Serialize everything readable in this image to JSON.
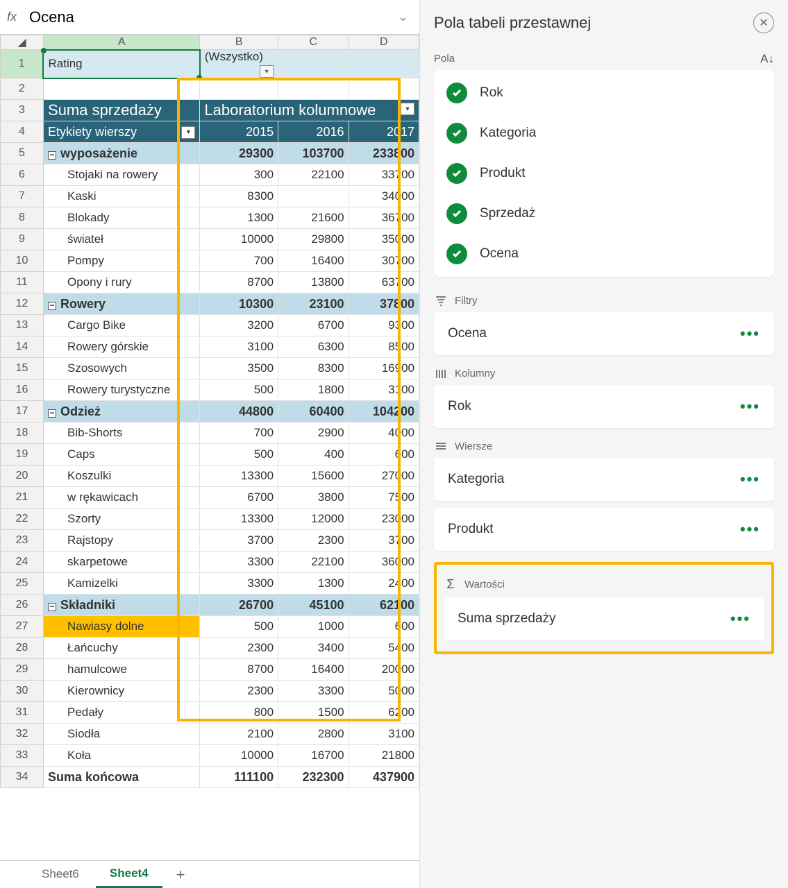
{
  "formula_bar": {
    "fx": "fx",
    "value": "Ocena"
  },
  "columns": [
    "A",
    "B",
    "C",
    "D"
  ],
  "active_cell": "Rating",
  "filter_all": "(Wszystko)",
  "pivot_header": {
    "measure": "Suma sprzedaży",
    "col_label": "Laboratorium kolumnowe"
  },
  "row_labels_header": "Etykiety wierszy",
  "years": [
    "2015",
    "2016",
    "2017"
  ],
  "groups": [
    {
      "name": "wyposażenie",
      "totals": [
        "29300",
        "103700",
        "233800"
      ],
      "rows": [
        {
          "p": "Stojaki na rowery",
          "v": [
            "300",
            "22100",
            "33700"
          ]
        },
        {
          "p": "Kaski",
          "v": [
            "8300",
            "",
            "34000"
          ]
        },
        {
          "p": "Blokady",
          "v": [
            "1300",
            "21600",
            "36700"
          ]
        },
        {
          "p": "świateł",
          "v": [
            "10000",
            "29800",
            "35000"
          ]
        },
        {
          "p": "Pompy",
          "v": [
            "700",
            "16400",
            "30700"
          ]
        },
        {
          "p": "Opony i rury",
          "v": [
            "8700",
            "13800",
            "63700"
          ]
        }
      ]
    },
    {
      "name": "Rowery",
      "totals": [
        "10300",
        "23100",
        "37800"
      ],
      "rows": [
        {
          "p": "Cargo Bike",
          "v": [
            "3200",
            "6700",
            "9300"
          ]
        },
        {
          "p": "Rowery górskie",
          "v": [
            "3100",
            "6300",
            "8500"
          ]
        },
        {
          "p": "Szosowych",
          "v": [
            "3500",
            "8300",
            "16900"
          ]
        },
        {
          "p": "Rowery turystyczne",
          "v": [
            "500",
            "1800",
            "3100"
          ]
        }
      ]
    },
    {
      "name": "Odzież",
      "totals": [
        "44800",
        "60400",
        "104200"
      ],
      "rows": [
        {
          "p": "Bib-Shorts",
          "v": [
            "700",
            "2900",
            "4000"
          ]
        },
        {
          "p": "Caps",
          "v": [
            "500",
            "400",
            "600"
          ]
        },
        {
          "p": "Koszulki",
          "v": [
            "13300",
            "15600",
            "27000"
          ]
        },
        {
          "p": "w rękawicach",
          "v": [
            "6700",
            "3800",
            "7500"
          ]
        },
        {
          "p": "Szorty",
          "v": [
            "13300",
            "12000",
            "23000"
          ]
        },
        {
          "p": "Rajstopy",
          "v": [
            "3700",
            "2300",
            "3700"
          ]
        },
        {
          "p": "skarpetowe",
          "v": [
            "3300",
            "22100",
            "36000"
          ]
        },
        {
          "p": "Kamizelki",
          "v": [
            "3300",
            "1300",
            "2400"
          ]
        }
      ]
    },
    {
      "name": "Składniki",
      "totals": [
        "26700",
        "45100",
        "62100"
      ],
      "rows": [
        {
          "p": "Nawiasy dolne",
          "v": [
            "500",
            "1000",
            "600"
          ],
          "hl": true
        },
        {
          "p": "Łańcuchy",
          "v": [
            "2300",
            "3400",
            "5400"
          ]
        },
        {
          "p": "hamulcowe",
          "v": [
            "8700",
            "16400",
            "20000"
          ]
        },
        {
          "p": "Kierownicy",
          "v": [
            "2300",
            "3300",
            "5000"
          ]
        },
        {
          "p": "Pedały",
          "v": [
            "800",
            "1500",
            "6200"
          ]
        },
        {
          "p": "Siodła",
          "v": [
            "2100",
            "2800",
            "3100"
          ]
        },
        {
          "p": "Koła",
          "v": [
            "10000",
            "16700",
            "21800"
          ]
        }
      ]
    }
  ],
  "grand_total": {
    "label": "Suma końcowa",
    "v": [
      "111100",
      "232300",
      "437900"
    ]
  },
  "tabs": {
    "items": [
      "Sheet6",
      "Sheet4"
    ],
    "active": 1
  },
  "panel": {
    "title": "Pola tabeli przestawnej",
    "fields_label": "Pola",
    "fields": [
      "Rok",
      "Kategoria",
      "Produkt",
      "Sprzedaż",
      "Ocena"
    ],
    "filters_label": "Filtry",
    "filters": [
      "Ocena"
    ],
    "columns_label": "Kolumny",
    "columns": [
      "Rok"
    ],
    "rows_label": "Wiersze",
    "rows": [
      "Kategoria",
      "Produkt"
    ],
    "values_label": "Wartości",
    "values": [
      "Suma sprzedaży"
    ]
  }
}
